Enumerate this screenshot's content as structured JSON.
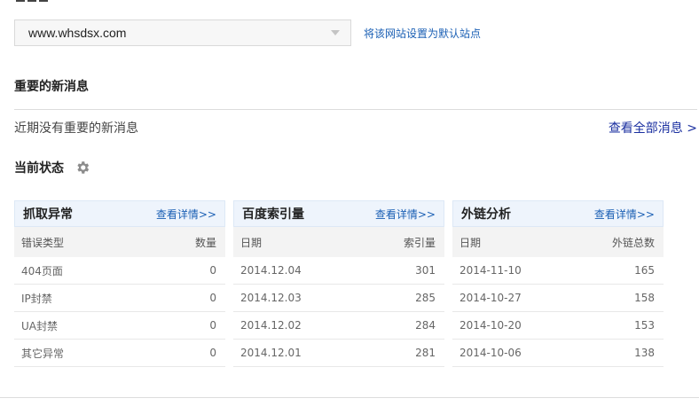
{
  "site": {
    "selected": "www.whsdsx.com",
    "set_default_link": "将该网站设置为默认站点"
  },
  "news": {
    "title": "重要的新消息",
    "empty_text": "近期没有重要的新消息",
    "view_all": "查看全部消息 >"
  },
  "status": {
    "title": "当前状态",
    "icon": "gear-icon"
  },
  "panels": [
    {
      "title": "抓取异常",
      "link": "查看详情>>",
      "col1": "错误类型",
      "col2": "数量",
      "rows": [
        {
          "a": "404页面",
          "b": "0"
        },
        {
          "a": "IP封禁",
          "b": "0"
        },
        {
          "a": "UA封禁",
          "b": "0"
        },
        {
          "a": "其它异常",
          "b": "0"
        }
      ]
    },
    {
      "title": "百度索引量",
      "link": "查看详情>>",
      "col1": "日期",
      "col2": "索引量",
      "rows": [
        {
          "a": "2014.12.04",
          "b": "301"
        },
        {
          "a": "2014.12.03",
          "b": "285"
        },
        {
          "a": "2014.12.02",
          "b": "284"
        },
        {
          "a": "2014.12.01",
          "b": "281"
        }
      ]
    },
    {
      "title": "外链分析",
      "link": "查看详情>>",
      "col1": "日期",
      "col2": "外链总数",
      "rows": [
        {
          "a": "2014-11-10",
          "b": "165"
        },
        {
          "a": "2014-10-27",
          "b": "158"
        },
        {
          "a": "2014-10-20",
          "b": "153"
        },
        {
          "a": "2014-10-06",
          "b": "138"
        }
      ]
    }
  ],
  "colors": {
    "link": "#1a5fb4",
    "panel_header_bg": "#eef4fc",
    "column_header_bg": "#f3f3f3"
  }
}
